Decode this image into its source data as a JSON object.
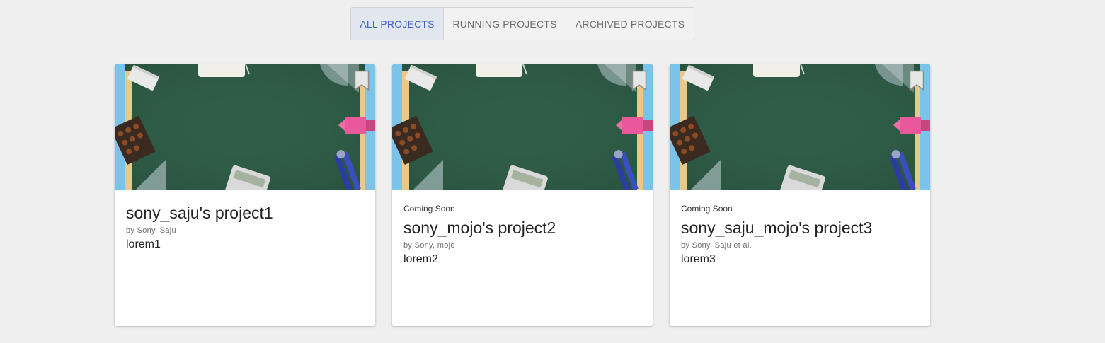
{
  "tabs": [
    {
      "label": "ALL PROJECTS",
      "active": true
    },
    {
      "label": "RUNNING PROJECTS",
      "active": false
    },
    {
      "label": "ARCHIVED PROJECTS",
      "active": false
    }
  ],
  "cards": [
    {
      "badge": "",
      "title": "sony_saju's project1",
      "author": "by Sony, Saju",
      "description": "lorem1",
      "image": "classroom-chalkboard-supplies",
      "icon": "bookmark-icon"
    },
    {
      "badge": "Coming Soon",
      "title": "sony_mojo's project2",
      "author": "by Sony, mojo",
      "description": "lorem2",
      "image": "classroom-chalkboard-supplies",
      "icon": "bookmark-icon"
    },
    {
      "badge": "Coming Soon",
      "title": "sony_saju_mojo's project3",
      "author": "by Sony, Saju et al.",
      "description": "lorem3",
      "image": "classroom-chalkboard-supplies",
      "icon": "bookmark-icon"
    }
  ],
  "colors": {
    "background": "#efefef",
    "active_tab_bg": "#e1e6ef",
    "active_tab_text": "#3f63c9",
    "chalkboard": "#2e5e47"
  }
}
